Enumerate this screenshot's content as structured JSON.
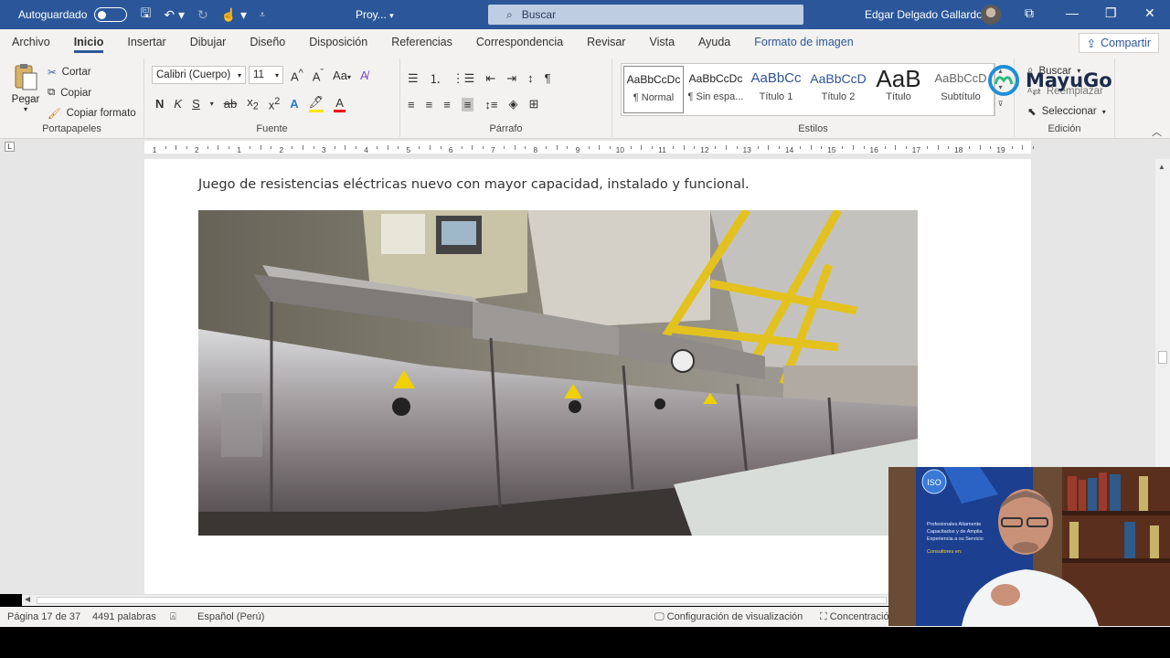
{
  "titlebar": {
    "autosave_label": "Autoguardado",
    "doc_name": "Proy...",
    "search_placeholder": "Buscar",
    "user_name": "Edgar Delgado Gallardo"
  },
  "tabs": [
    "Archivo",
    "Inicio",
    "Insertar",
    "Dibujar",
    "Diseño",
    "Disposición",
    "Referencias",
    "Correspondencia",
    "Revisar",
    "Vista",
    "Ayuda",
    "Formato de imagen"
  ],
  "share_label": "Compartir",
  "clipboard": {
    "paste": "Pegar",
    "cut": "Cortar",
    "copy": "Copiar",
    "format_painter": "Copiar formato",
    "label": "Portapapeles"
  },
  "font": {
    "name": "Calibri (Cuerpo)",
    "size": "11",
    "change_case": "Aa",
    "label": "Fuente"
  },
  "paragraph": {
    "label": "Párrafo"
  },
  "styles": {
    "items": [
      {
        "preview": "AaBbCcDc",
        "name": "¶ Normal"
      },
      {
        "preview": "AaBbCcDc",
        "name": "¶ Sin espa..."
      },
      {
        "preview": "AaBbCc",
        "name": "Título 1"
      },
      {
        "preview": "AaBbCcD",
        "name": "Título 2"
      },
      {
        "preview": "AaB",
        "name": "Título"
      },
      {
        "preview": "AaBbCcD",
        "name": "Subtítulo"
      }
    ],
    "label": "Estilos"
  },
  "editing": {
    "find": "Buscar",
    "replace": "Reemplazar",
    "select": "Seleccionar",
    "label": "Edición"
  },
  "logo_text": "MayuGo",
  "ruler_numbers": [
    "1",
    "2",
    "1",
    "2",
    "3",
    "4",
    "5",
    "6",
    "7",
    "8",
    "9",
    "10",
    "11",
    "12",
    "13",
    "14",
    "15",
    "16",
    "17",
    "18",
    "19"
  ],
  "document": {
    "paragraph": "Juego de resistencias eléctricas nuevo con mayor capacidad, instalado y funcional."
  },
  "status": {
    "page": "Página 17 de 37",
    "words": "4491 palabras",
    "language": "Español (Perú)",
    "display_settings": "Configuración de visualización",
    "focus": "Concentración"
  },
  "webcam_poster": {
    "badge": "ISO",
    "lines": [
      "Profesionales Altamente",
      "Capacitados y de Amplia",
      "Experiencia a su Servicio",
      "Consultores en:"
    ]
  },
  "colors": {
    "word_blue": "#2b579a",
    "ribbon": "#f3f2f1",
    "canvas": "#e6e6e6"
  }
}
